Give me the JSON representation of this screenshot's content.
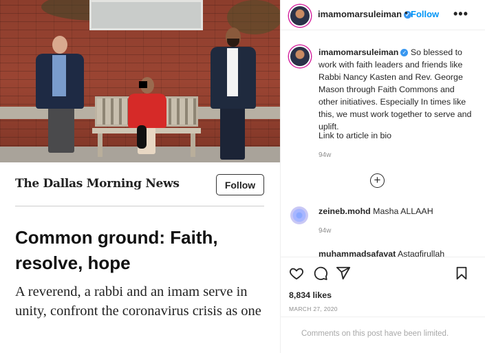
{
  "post_image": {
    "publisher": "The Dallas Morning News",
    "follow_label": "Follow",
    "headline": "Common ground: Faith, resolve, hope",
    "subhead": "A reverend, a rabbi and an imam serve in unity, confront the coronavirus crisis as one"
  },
  "header": {
    "username": "imamomarsuleiman",
    "verified_glyph": "✓",
    "separator": "•",
    "follow_label": "Follow",
    "more_glyph": "•••"
  },
  "caption": {
    "username": "imamomarsuleiman",
    "text": " So blessed to work with faith leaders and friends like Rabbi Nancy Kasten and Rev. George Mason through Faith Commons and other initiatives. Especially In times like this, we must work together to serve and uplift.",
    "link_text": "Link to article in bio",
    "age": "94w"
  },
  "load_more_glyph": "+",
  "comments": [
    {
      "username": "zeineb.mohd",
      "text": " Masha ALLAAH",
      "age": "94w"
    },
    {
      "username": "muhammadsafavat",
      "text": " Astagfirullah"
    }
  ],
  "actions": {
    "likes": "8,834 likes",
    "date": "MARCH 27, 2020",
    "comments_limited": "Comments on this post have been limited."
  },
  "colors": {
    "accent": "#0095f6",
    "verified": "#3897f0",
    "muted": "#8e8e8e"
  }
}
